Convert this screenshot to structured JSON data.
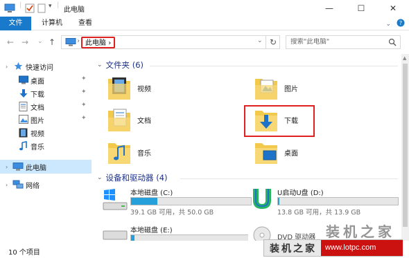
{
  "window": {
    "title": "此电脑",
    "minimize_glyph": "—",
    "maximize_glyph": "☐",
    "close_glyph": "✕"
  },
  "ribbon": {
    "tabs": [
      {
        "label": "文件"
      },
      {
        "label": "计算机"
      },
      {
        "label": "查看"
      }
    ]
  },
  "nav": {
    "back_glyph": "←",
    "forward_glyph": "→",
    "recent_glyph": "⌄",
    "up_glyph": "↑",
    "breadcrumb": "此电脑",
    "breadcrumb_sep": "›",
    "dropdown_glyph": "⌄",
    "refresh_glyph": "↻",
    "search_placeholder": "搜索\"此电脑\""
  },
  "sidebar": {
    "quick_access": "快速访问",
    "items": [
      {
        "label": "桌面",
        "pinned": true
      },
      {
        "label": "下载",
        "pinned": true
      },
      {
        "label": "文档",
        "pinned": true
      },
      {
        "label": "图片",
        "pinned": true
      },
      {
        "label": "视频",
        "pinned": false
      },
      {
        "label": "音乐",
        "pinned": false
      }
    ],
    "this_pc": "此电脑",
    "network": "网络",
    "pin_glyph": "✦"
  },
  "main": {
    "folders_header": "文件夹 (6)",
    "folders": [
      {
        "label": "视频",
        "icon": "video-folder-icon"
      },
      {
        "label": "图片",
        "icon": "pictures-folder-icon"
      },
      {
        "label": "文档",
        "icon": "documents-folder-icon"
      },
      {
        "label": "下载",
        "icon": "downloads-folder-icon"
      },
      {
        "label": "音乐",
        "icon": "music-folder-icon"
      },
      {
        "label": "桌面",
        "icon": "desktop-folder-icon"
      }
    ],
    "drives_header": "设备和驱动器 (4)",
    "drives": [
      {
        "name": "本地磁盘 (C:)",
        "size": "39.1 GB 可用，共 50.0 GB",
        "used_fraction": 0.22
      },
      {
        "name": "U启动U盘 (D:)",
        "size": "13.8 GB 可用，共 13.9 GB",
        "used_fraction": 0.01
      },
      {
        "name": "本地磁盘 (E:)",
        "size": "",
        "used_fraction": 0.03
      },
      {
        "name": "DVD 驱动器",
        "size": "",
        "used_fraction": 0
      }
    ]
  },
  "status": {
    "items_count": "10 个项目"
  },
  "watermark": {
    "top_text": "装机之家",
    "banner_text": "装机之家",
    "url": "www.lotpc.com"
  },
  "colors": {
    "accent": "#1979ca",
    "highlight": "#e02020",
    "drive_bar": "#26a0da",
    "header_text": "#1e3287"
  }
}
